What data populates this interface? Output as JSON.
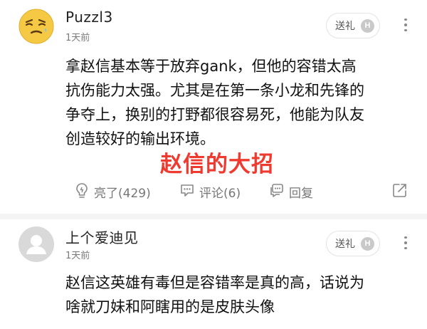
{
  "comments": [
    {
      "username": "Puzzl3",
      "time": "1天前",
      "gift_label": "送礼",
      "gift_badge": "H",
      "text": "拿赵信基本等于放弃gank，但他的容错太高\n抗伤能力太强。尤其是在第一条小龙和先锋的\n争夺上，换别的打野都很容易死，他能为队友\n创造较好的输出环境。",
      "actions": {
        "like": "亮了(429)",
        "comment": "评论(6)",
        "reply": "回复"
      }
    },
    {
      "username": "上个爱迪见",
      "time": "1天前",
      "gift_label": "送礼",
      "gift_badge": "H",
      "text": "赵信这英雄有毒但是容错率是真的高，话说为\n啥就刀妹和阿瞎用的是皮肤头像"
    }
  ],
  "overlay_caption": "赵信的大招",
  "colors": {
    "overlay": "#ef3a2f",
    "emoji_face": "#f6c944",
    "default_avatar": "#d9d9d9"
  }
}
